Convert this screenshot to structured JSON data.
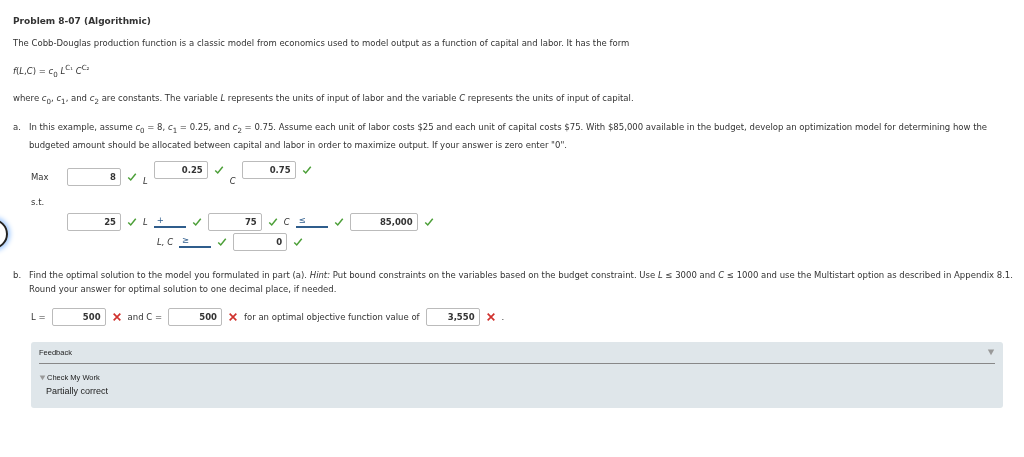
{
  "title": "Problem 8-07 (Algorithmic)",
  "intro": "The Cobb-Douglas production function is a classic model from economics used to model output as a function of capital and labor. It has the form",
  "formula": "*f*(*L*,*C*) = *c*$_{0}$ *L*$^{C₁}$ *C*$^{C₂}$",
  "where": "where *c*$_{0}$, *c*$_{1}$, and *c*$_{2}$ are constants. The variable *L* represents the units of input of labor and the variable *C* represents the units of input of capital.",
  "part_a": {
    "label": "a.",
    "text": "In this example, assume *c*$_{0}$ = 8, *c*$_{1}$ = 0.25, and *c*$_{2}$ = 0.75. Assume each unit of labor costs $25 and each unit of capital costs $75. With $85,000 available in the budget, develop an optimization model for determining how the budgeted amount should be allocated between capital and labor in order to maximize output. If your answer is zero enter \"0\"."
  },
  "objective": {
    "label": "Max",
    "coef": {
      "value": "8",
      "correct": true
    },
    "var1": "L",
    "exp1": {
      "value": "0.25",
      "correct": true
    },
    "var2": "C",
    "exp2": {
      "value": "0.75",
      "correct": true
    }
  },
  "st_label": "s.t.",
  "constraint": {
    "coef1": {
      "value": "25",
      "correct": true
    },
    "var1": "L",
    "op1": {
      "value": "+",
      "correct": true
    },
    "coef2": {
      "value": "75",
      "correct": true
    },
    "var2": "C",
    "op2": {
      "value": "≤",
      "correct": true
    },
    "rhs": {
      "value": "85,000",
      "correct": true
    }
  },
  "nonneg": {
    "vars": "L, C",
    "op": {
      "value": "≥",
      "correct": true
    },
    "rhs": {
      "value": "0",
      "correct": true
    }
  },
  "part_b": {
    "label": "b.",
    "text": "Find the optimal solution to the model you formulated in part (a). *Hint:* Put bound constraints on the variables based on the budget constraint. Use *L* ≤ 3000 and *C* ≤ 1000 and use the Multistart option as described in Appendix 8.1.",
    "round_note": "Round your answer for optimal solution to one decimal place, if needed."
  },
  "answer": {
    "l_label": "L =",
    "l": {
      "value": "500",
      "correct": false
    },
    "c_label": "and C =",
    "c": {
      "value": "500",
      "correct": false
    },
    "obj_label": "for an optimal objective function value of",
    "obj": {
      "value": "3,550",
      "correct": false
    },
    "end": "."
  },
  "feedback": {
    "title": "Feedback",
    "check_label": "Check My Work",
    "expanded": true,
    "result": "Partially correct"
  }
}
